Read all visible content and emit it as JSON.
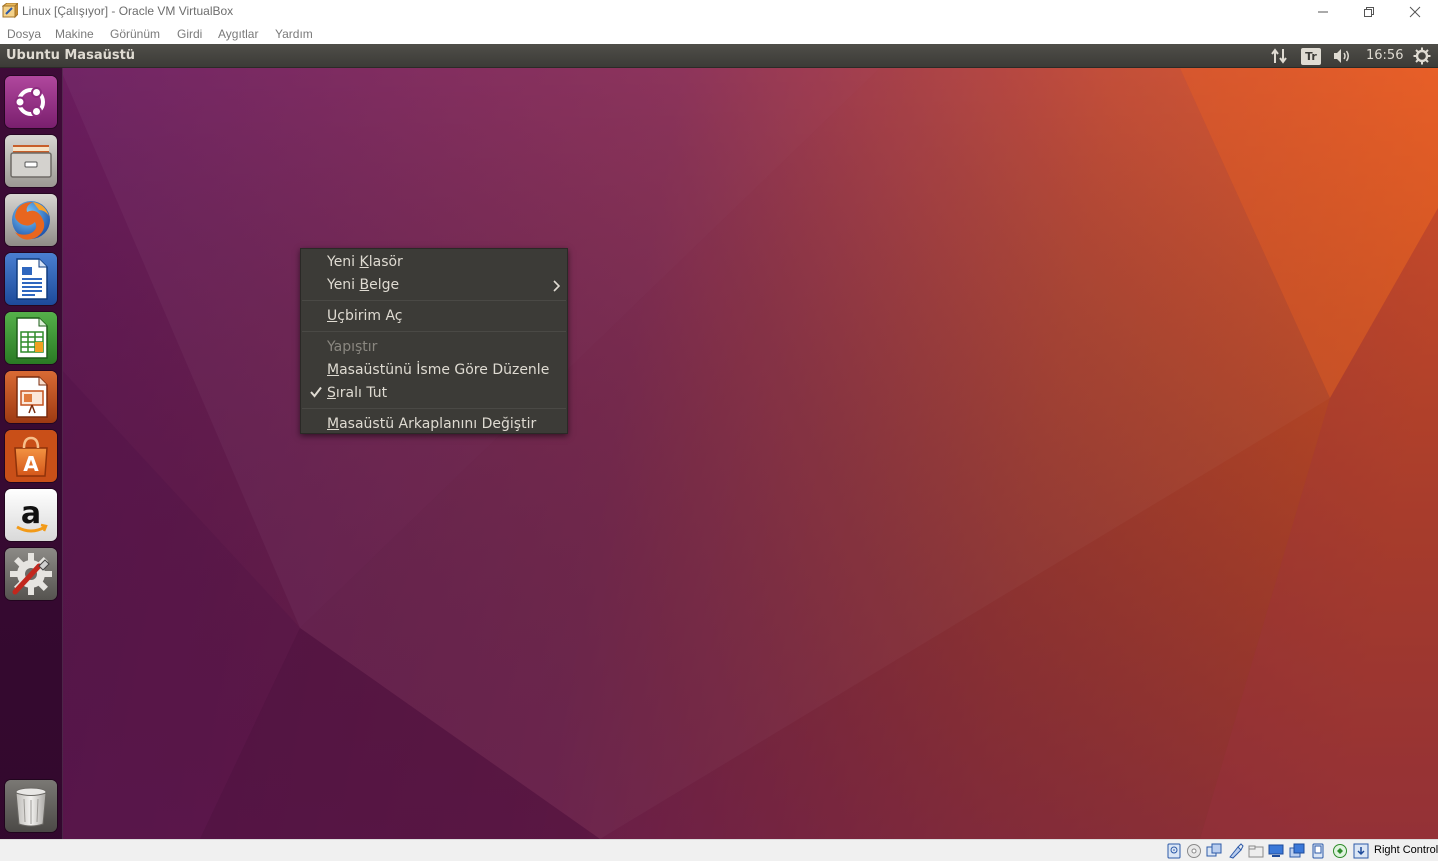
{
  "window": {
    "title": "Linux [Çalışıyor] - Oracle VM VirtualBox",
    "app_icon": "virtualbox-icon",
    "controls": [
      "minimize-icon",
      "restore-icon",
      "close-icon"
    ]
  },
  "menubar": {
    "items": [
      {
        "label": "Dosya"
      },
      {
        "label": "Makine"
      },
      {
        "label": "Görünüm"
      },
      {
        "label": "Girdi"
      },
      {
        "label": "Aygıtlar"
      },
      {
        "label": "Yardım"
      }
    ]
  },
  "panel": {
    "title": "Ubuntu Masaüstü",
    "keyboard_layout": "Tr",
    "clock": "16:56",
    "indicators": [
      "network-arrows-icon",
      "keyboard-layout-indicator",
      "volume-icon",
      "session-gear-icon"
    ]
  },
  "launcher": {
    "items": [
      {
        "icon": "ubuntu-dash-icon"
      },
      {
        "icon": "files-icon"
      },
      {
        "icon": "firefox-icon"
      },
      {
        "icon": "libreoffice-writer-icon"
      },
      {
        "icon": "libreoffice-calc-icon"
      },
      {
        "icon": "libreoffice-impress-icon"
      },
      {
        "icon": "ubuntu-software-icon"
      },
      {
        "icon": "amazon-icon"
      },
      {
        "icon": "system-settings-icon"
      },
      {
        "icon": "trash-icon"
      }
    ]
  },
  "context_menu": {
    "items": [
      {
        "label": "Yeni Klasör",
        "mnemonic": "K",
        "enabled": true,
        "has_submenu": false,
        "checked": false
      },
      {
        "label": "Yeni Belge",
        "mnemonic": "B",
        "enabled": true,
        "has_submenu": true,
        "checked": false
      },
      {
        "label": "Uçbirim Aç",
        "mnemonic": "U",
        "enabled": true,
        "has_submenu": false,
        "checked": false
      },
      {
        "label": "Yapıştır",
        "mnemonic": "",
        "enabled": false,
        "has_submenu": false,
        "checked": false
      },
      {
        "label": "Masaüstünü İsme Göre Düzenle",
        "mnemonic": "M",
        "enabled": true,
        "has_submenu": false,
        "checked": false
      },
      {
        "label": "Sıralı Tut",
        "mnemonic": "S",
        "enabled": true,
        "has_submenu": false,
        "checked": true
      },
      {
        "label": "Masaüstü Arkaplanını Değiştir",
        "mnemonic": "M",
        "enabled": true,
        "has_submenu": false,
        "checked": false
      }
    ]
  },
  "statusbar": {
    "icons": [
      "hard-disk-icon",
      "optical-drive-icon",
      "audio-icon",
      "network-icon",
      "usb-icon",
      "shared-folders-icon",
      "display-icon",
      "video-capture-icon",
      "cpu-icon",
      "mouse-integration-icon",
      "keyboard-capture-icon"
    ],
    "host_key": "Right Control"
  },
  "colors": {
    "panel_bg": "#3c3b37",
    "menu_bg": "#3c3b37",
    "menu_text": "#dfdbd2",
    "wallpaper_purple": "#6e1e5e",
    "wallpaper_orange": "#e35a25"
  }
}
